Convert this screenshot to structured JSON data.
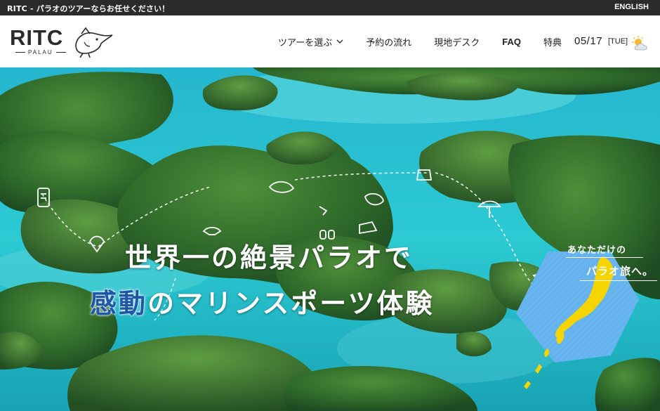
{
  "topbar": {
    "tagline": "RITC - パラオのツアーならお任せください！",
    "language_link": "ENGLISH"
  },
  "header": {
    "logo_text": "RITC",
    "logo_sub": "PALAU",
    "nav": [
      {
        "label": "ツアーを選ぶ",
        "icon": "chevron-down-icon"
      },
      {
        "label": "予約の流れ"
      },
      {
        "label": "現地デスク"
      },
      {
        "label": "FAQ"
      },
      {
        "label": "特典"
      }
    ],
    "date": "05/17",
    "weekday": "[TUE]",
    "weather_icon": "sun-cloud-icon"
  },
  "hero": {
    "headline_line1": "世界一の絶景パラオで",
    "headline_line2_highlight": "感動",
    "headline_line2_rest": "のマリンスポーツ体験",
    "badge_line1": "あなただけの",
    "badge_line2": "パラオ旅へ。",
    "colors": {
      "lagoon": "#2ec6d6",
      "island_green": "#2f6b2a",
      "highlight_blue": "#1d57a8",
      "map_blue": "#5aa8e6",
      "map_yellow": "#f5d400"
    }
  }
}
